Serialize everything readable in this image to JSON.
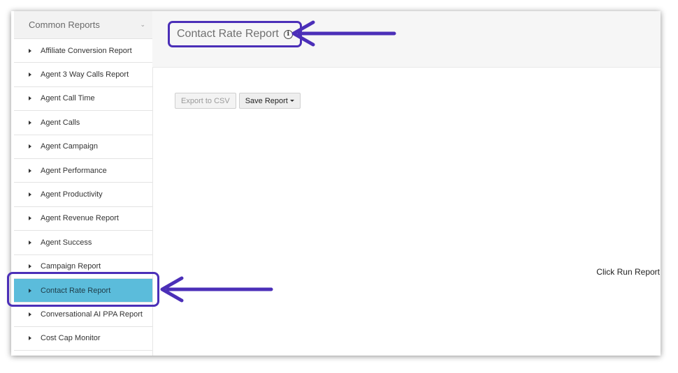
{
  "sidebar": {
    "header": "Common Reports",
    "items": [
      {
        "label": "Affiliate Conversion Report"
      },
      {
        "label": "Agent 3 Way Calls Report"
      },
      {
        "label": "Agent Call Time"
      },
      {
        "label": "Agent Calls"
      },
      {
        "label": "Agent Campaign"
      },
      {
        "label": "Agent Performance"
      },
      {
        "label": "Agent Productivity"
      },
      {
        "label": "Agent Revenue Report"
      },
      {
        "label": "Agent Success"
      },
      {
        "label": "Campaign Report"
      },
      {
        "label": "Contact Rate Report",
        "active": true
      },
      {
        "label": "Conversational AI PPA Report"
      },
      {
        "label": "Cost Cap Monitor"
      }
    ]
  },
  "main": {
    "title": "Contact Rate Report",
    "info_icon_glyph": "i",
    "export_label": "Export to CSV",
    "save_label": "Save Report",
    "empty_message": "Click Run Report"
  },
  "colors": {
    "active_item": "#5bbcdb",
    "annotation": "#4b2fb8"
  }
}
